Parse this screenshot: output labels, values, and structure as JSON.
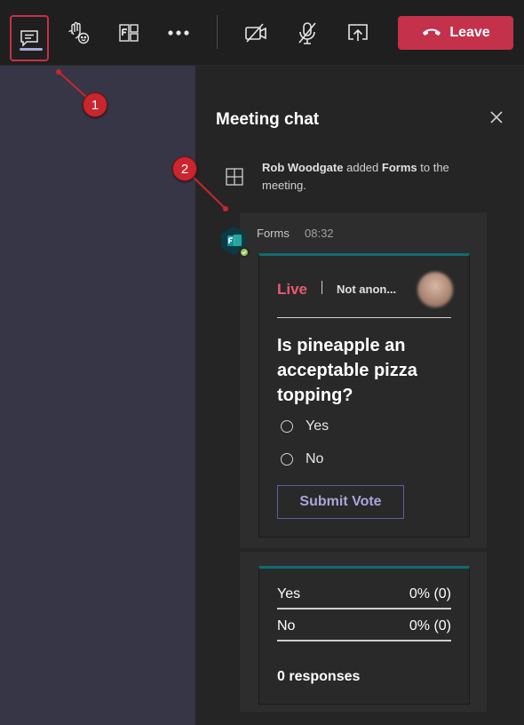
{
  "toolbar": {
    "buttons": [
      {
        "icon": "chat-icon"
      },
      {
        "icon": "raise-hand-icon"
      },
      {
        "icon": "apps-icon"
      },
      {
        "icon": "more-options-icon"
      },
      {
        "icon": "camera-off-icon"
      },
      {
        "icon": "mic-off-icon"
      },
      {
        "icon": "share-screen-icon"
      }
    ],
    "leave_label": "Leave",
    "leave_color": "#c4314b"
  },
  "chat": {
    "title": "Meeting chat",
    "system_message": {
      "actor": "Rob Woodgate",
      "action": "added",
      "object": "Forms",
      "suffix": "to the meeting."
    },
    "message": {
      "sender": "Forms",
      "time": "08:32"
    },
    "poll": {
      "status": "Live",
      "anonymity": "Not anon...",
      "question": "Is pineapple an acceptable pizza topping?",
      "options": [
        "Yes",
        "No"
      ],
      "submit_label": "Submit Vote"
    },
    "results": {
      "rows": [
        {
          "label": "Yes",
          "value": "0% (0)",
          "fraction": 0
        },
        {
          "label": "No",
          "value": "0% (0)",
          "fraction": 0
        }
      ],
      "total": "0 responses"
    }
  },
  "callouts": [
    "1",
    "2"
  ],
  "colors": {
    "accent": "#a6a7dc",
    "live": "#e85b71",
    "callout": "#c9262e",
    "card_top": "#0f6c72"
  }
}
